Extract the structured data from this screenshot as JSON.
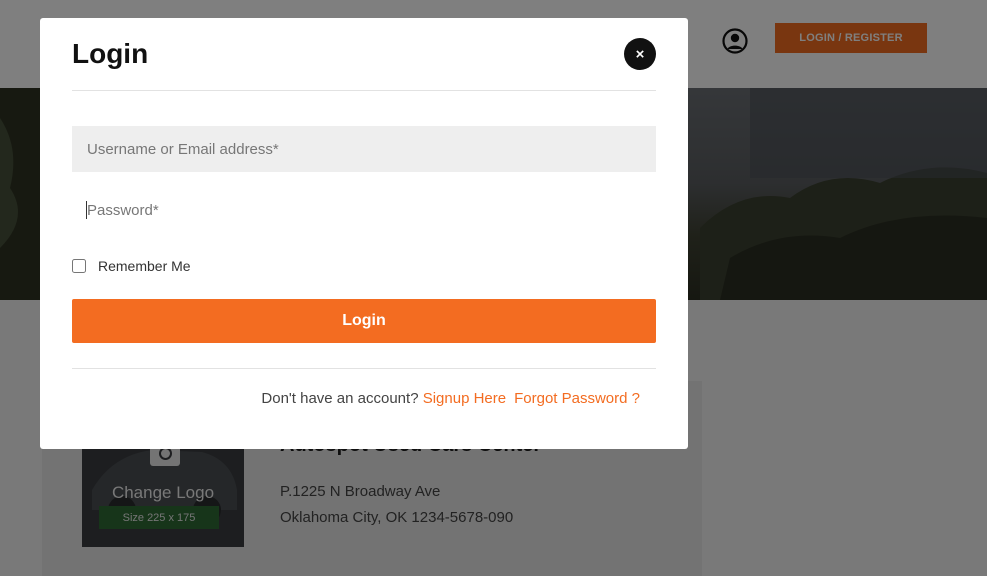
{
  "header": {
    "login_register_label": "LOGIN / REGISTER"
  },
  "dealer": {
    "change_logo_label": "Change Logo",
    "logo_size_label": "Size 225 x 175",
    "name": "Autospot Used Cars Center",
    "address_line1": "P.1225 N Broadway Ave",
    "address_line2": "Oklahoma City, OK 1234-5678-090"
  },
  "modal": {
    "title": "Login",
    "close_label": "×",
    "username_placeholder": "Username or Email address*",
    "password_placeholder": "Password*",
    "remember_label": "Remember Me",
    "login_button_label": "Login",
    "no_account_text": "Don't have an account?",
    "signup_link": "Signup Here",
    "forgot_link": "Forgot Password ?"
  },
  "colors": {
    "accent": "#f36c21",
    "overlay": "rgba(0,0,0,0.5)"
  },
  "icons": {
    "user": "user-circle-icon",
    "close": "close-icon",
    "camera": "camera-icon"
  }
}
